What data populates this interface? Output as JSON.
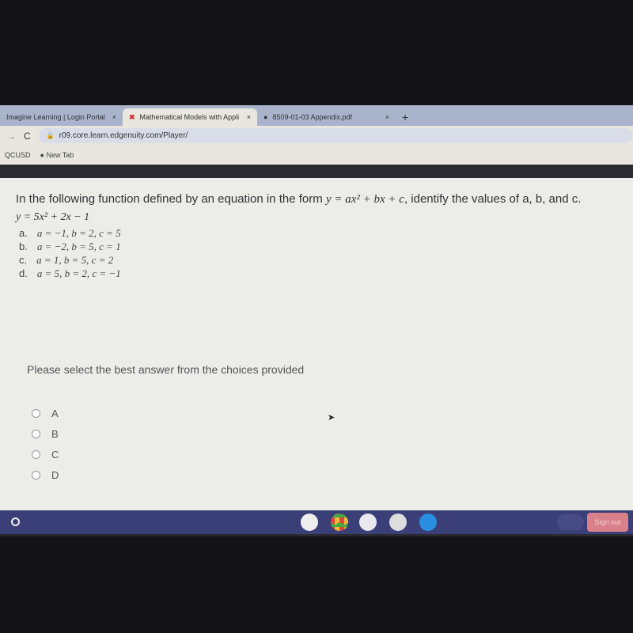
{
  "browser": {
    "tabs": [
      {
        "title": "Imagine Learning | Login Portal",
        "close": "×"
      },
      {
        "title": "Mathematical Models with Appli",
        "close": "×"
      },
      {
        "title": "8509-01-03 Appendix.pdf",
        "close": "×"
      }
    ],
    "new_tab": "+",
    "url": "r09.core.learn.edgenuity.com/Player/",
    "bookmarks": [
      "QCUSD",
      "New Tab"
    ]
  },
  "question": {
    "text_before": "In the following function defined by an equation in the form ",
    "form": "y = ax² + bx + c",
    "text_after": ", identify the values of a, b, and c.",
    "equation": "y = 5x² + 2x − 1",
    "options": [
      {
        "letter": "a.",
        "value": "a = −1, b = 2, c = 5"
      },
      {
        "letter": "b.",
        "value": "a = −2, b = 5, c = 1"
      },
      {
        "letter": "c.",
        "value": "a = 1, b = 5, c = 2"
      },
      {
        "letter": "d.",
        "value": "a = 5, b = 2, c = −1"
      }
    ]
  },
  "answer": {
    "prompt": "Please select the best answer from the choices provided",
    "choices": [
      "A",
      "B",
      "C",
      "D"
    ]
  },
  "shelf": {
    "sign_out": "Sign out"
  }
}
